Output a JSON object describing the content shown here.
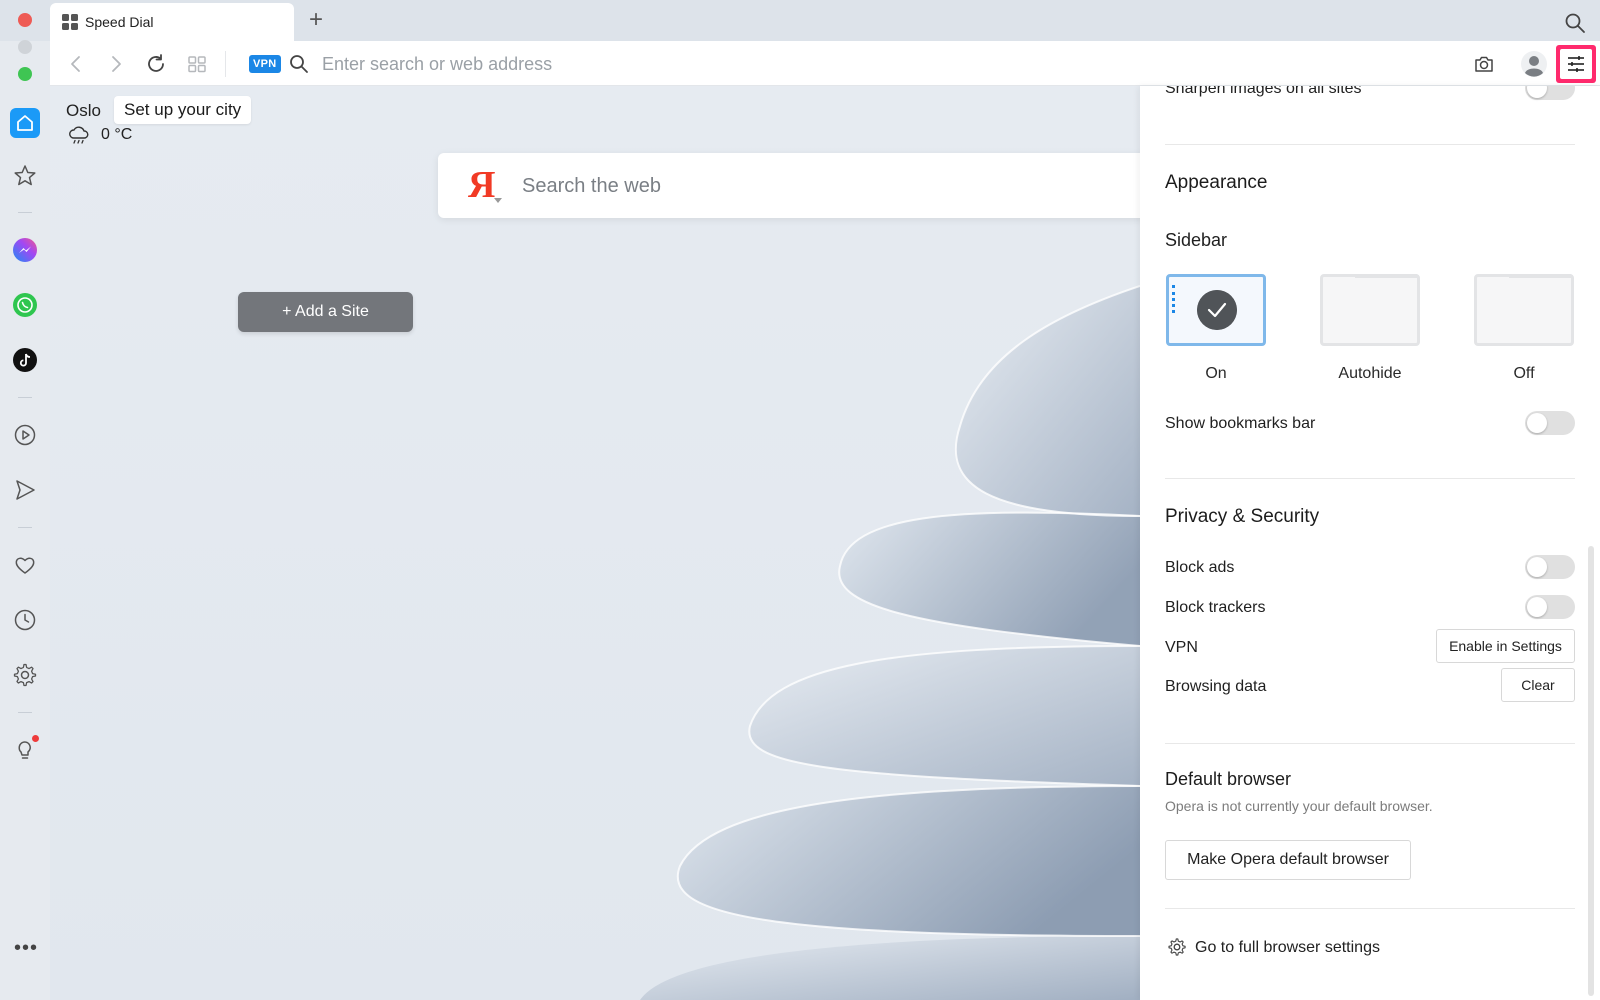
{
  "tab": {
    "title": "Speed Dial"
  },
  "addressbar": {
    "vpn_label": "VPN",
    "placeholder": "Enter search or web address"
  },
  "weather": {
    "city": "Oslo",
    "tooltip": "Set up your city",
    "temperature": "0 °C"
  },
  "websearch": {
    "logo": "Я",
    "placeholder": "Search the web"
  },
  "speeddial": {
    "add_site_label": "+ Add a Site"
  },
  "panel": {
    "sharpen_label": "Sharpen images on all sites",
    "appearance_heading": "Appearance",
    "sidebar_heading": "Sidebar",
    "sidebar_options": [
      {
        "label": "On",
        "selected": true
      },
      {
        "label": "Autohide",
        "selected": false
      },
      {
        "label": "Off",
        "selected": false
      }
    ],
    "bookmarks_bar_label": "Show bookmarks bar",
    "privacy_heading": "Privacy & Security",
    "block_ads_label": "Block ads",
    "block_trackers_label": "Block trackers",
    "vpn_label": "VPN",
    "vpn_button": "Enable in Settings",
    "browsing_data_label": "Browsing data",
    "clear_button": "Clear",
    "default_heading": "Default browser",
    "default_sub": "Opera is not currently your default browser.",
    "default_button": "Make Opera default browser",
    "full_settings_label": "Go to full browser settings"
  },
  "colors": {
    "accent": "#1b9af7",
    "easy_setup_highlight": "#ff2a6d",
    "yandex": "#f13a25"
  }
}
